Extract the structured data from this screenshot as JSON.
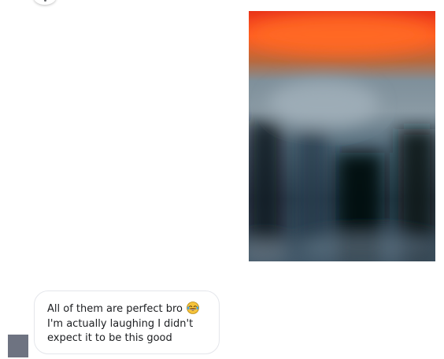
{
  "conversation": {
    "incoming_message": {
      "lines": [
        "All of them are perfect bro",
        "I'm actually laughing I didn't",
        "expect it to be this good"
      ],
      "emoji": "laughing-with-tears-emoji"
    },
    "photo_attachment": {
      "blurred": true
    }
  },
  "colors": {
    "bubble_border": "#e4e6eb",
    "text": "#1c1e21",
    "avatar": "#6e7381",
    "photo_top": "#ff5a1f",
    "photo_mid": "#6f8593",
    "photo_bottom": "#0e1a22"
  }
}
